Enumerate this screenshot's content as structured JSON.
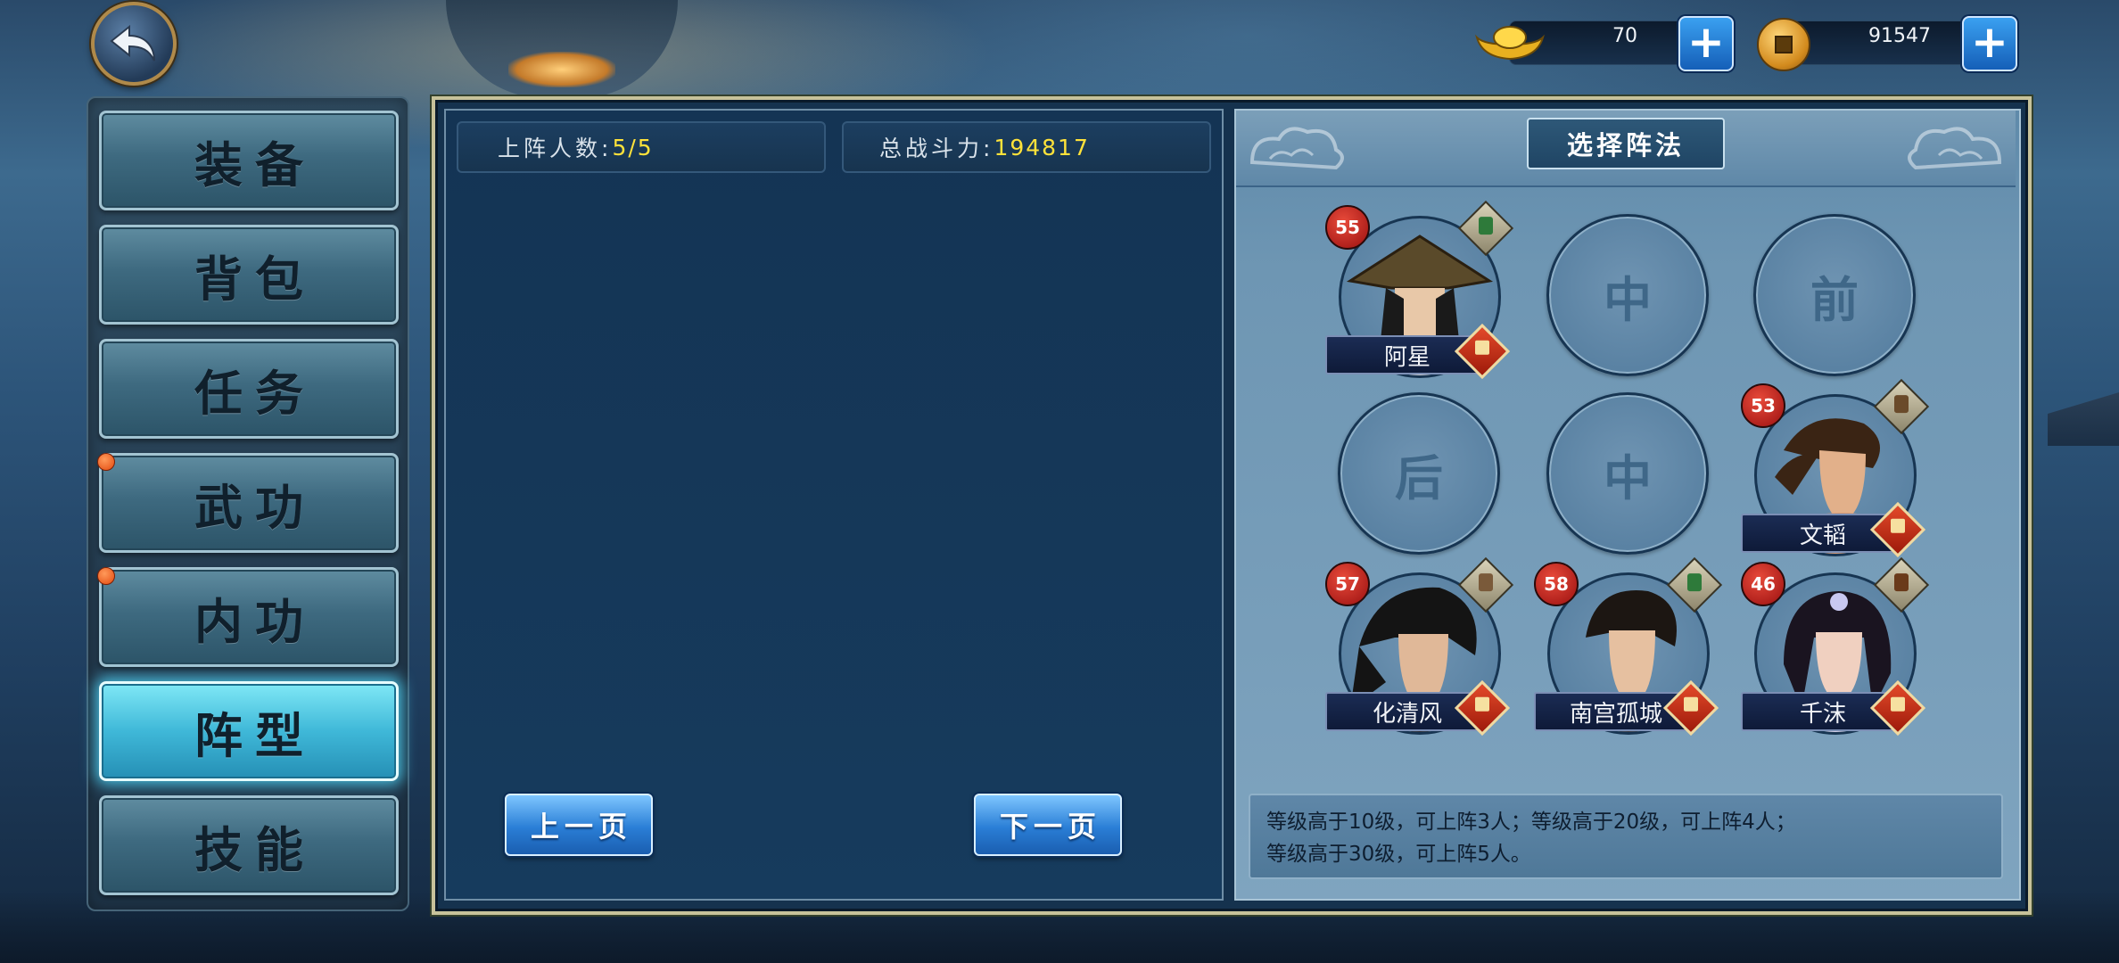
{
  "currencies": {
    "gold_ingot": {
      "value": "70",
      "icon": "gold-ingot-icon"
    },
    "copper_coin": {
      "value": "91547",
      "icon": "copper-coin-icon"
    }
  },
  "nav": {
    "items": [
      {
        "label": "装备",
        "active": false,
        "badge": false
      },
      {
        "label": "背包",
        "active": false,
        "badge": false
      },
      {
        "label": "任务",
        "active": false,
        "badge": false
      },
      {
        "label": "武功",
        "active": false,
        "badge": true
      },
      {
        "label": "内功",
        "active": false,
        "badge": true
      },
      {
        "label": "阵型",
        "active": true,
        "badge": false
      },
      {
        "label": "技能",
        "active": false,
        "badge": false
      }
    ]
  },
  "stats": {
    "deployed_label": "上阵人数:",
    "deployed_value": "5/5",
    "power_label": "总战斗力:",
    "power_value": "194817"
  },
  "pager": {
    "prev": "上一页",
    "next": "下一页"
  },
  "formation": {
    "title": "选择阵法",
    "empty_slots": [
      "中",
      "前",
      "后",
      "中"
    ],
    "heroes": [
      {
        "name": "阿星",
        "level": "55"
      },
      {
        "name": "文韬",
        "level": "53"
      },
      {
        "name": "化清风",
        "level": "57"
      },
      {
        "name": "南宫孤城",
        "level": "58"
      },
      {
        "name": "千沫",
        "level": "46"
      }
    ],
    "info_line1": "等级高于10级，可上阵3人；等级高于20级，可上阵4人；",
    "info_line2": "等级高于30级，可上阵5人。"
  },
  "colors": {
    "accent_yellow": "#ffe23a",
    "active_tab": "#3fb8d8",
    "plus_button": "#2a7ed6"
  }
}
